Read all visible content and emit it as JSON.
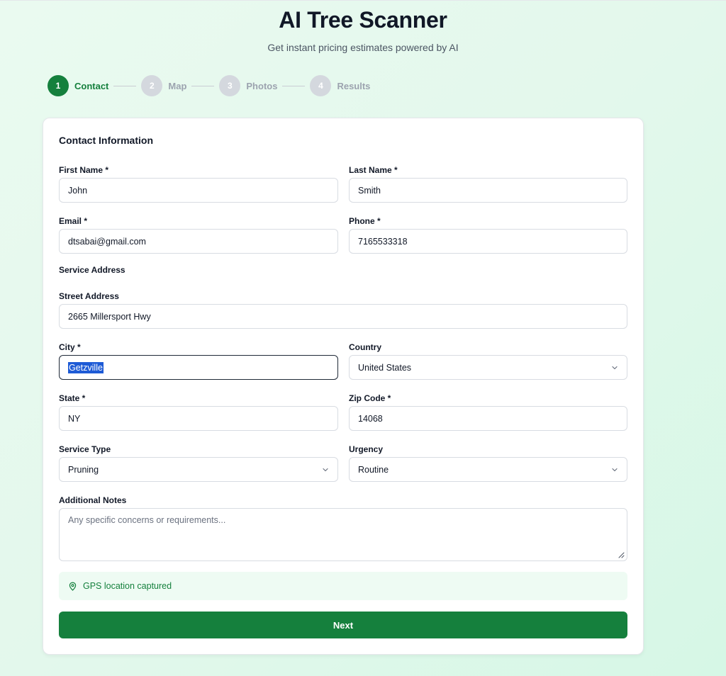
{
  "header": {
    "title": "AI Tree Scanner",
    "subtitle": "Get instant pricing estimates powered by AI"
  },
  "stepper": {
    "steps": [
      {
        "number": "1",
        "label": "Contact",
        "active": true
      },
      {
        "number": "2",
        "label": "Map",
        "active": false
      },
      {
        "number": "3",
        "label": "Photos",
        "active": false
      },
      {
        "number": "4",
        "label": "Results",
        "active": false
      }
    ]
  },
  "form": {
    "title": "Contact Information",
    "first_name": {
      "label": "First Name *",
      "value": "John"
    },
    "last_name": {
      "label": "Last Name *",
      "value": "Smith"
    },
    "email": {
      "label": "Email *",
      "value": "dtsabai@gmail.com"
    },
    "phone": {
      "label": "Phone *",
      "value": "7165533318"
    },
    "service_address_heading": "Service Address",
    "street": {
      "label": "Street Address",
      "value": "2665 Millersport Hwy"
    },
    "city": {
      "label": "City *",
      "value": "Getzville"
    },
    "country": {
      "label": "Country",
      "value": "United States"
    },
    "state": {
      "label": "State *",
      "value": "NY"
    },
    "zip": {
      "label": "Zip Code *",
      "value": "14068"
    },
    "service_type": {
      "label": "Service Type",
      "value": "Pruning"
    },
    "urgency": {
      "label": "Urgency",
      "value": "Routine"
    },
    "notes": {
      "label": "Additional Notes",
      "placeholder": "Any specific concerns or requirements..."
    },
    "gps_status": "GPS location captured",
    "next_label": "Next"
  },
  "colors": {
    "accent": "#15803d",
    "inactive_step": "#d4d8de",
    "gps_bg": "#eefbf3"
  },
  "icons": {
    "gps": "map-pin-icon",
    "select": "chevron-down-icon",
    "resize": "resize-handle-icon"
  }
}
